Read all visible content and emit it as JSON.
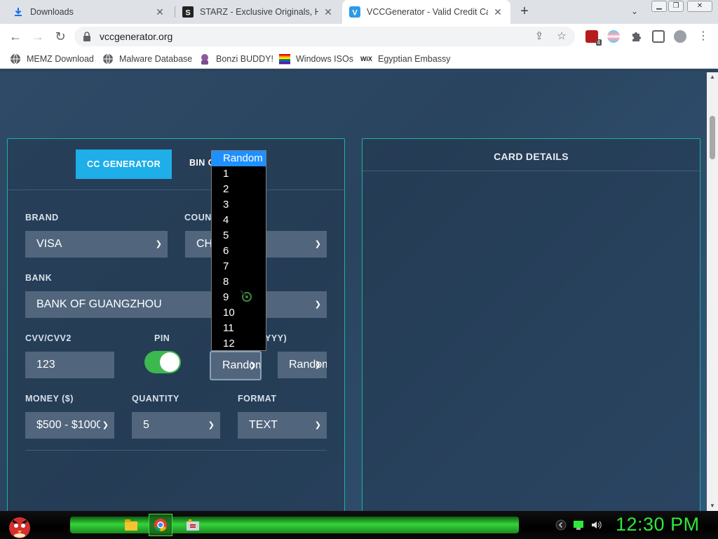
{
  "browser": {
    "tabs": [
      {
        "label": "Downloads",
        "favicon": "download-icon"
      },
      {
        "label": "STARZ - Exclusive Originals, Hit M",
        "favicon": "starz-icon"
      },
      {
        "label": "VCCGenerator - Valid Credit Card",
        "favicon": "vcc-icon",
        "active": true
      }
    ],
    "url": "vccgenerator.org",
    "bookmarks": [
      {
        "label": "MEMZ Download",
        "icon": "globe-icon"
      },
      {
        "label": "Malware Database",
        "icon": "globe-icon"
      },
      {
        "label": "Bonzi BUDDY!",
        "icon": "bonzi-icon"
      },
      {
        "label": "Windows ISOs",
        "icon": "windows-icon"
      },
      {
        "label": "Egyptian Embassy",
        "icon": "wix-icon"
      }
    ],
    "wix_mark": "WiX",
    "extension_badge": "4"
  },
  "generator": {
    "tab_cc": "CC GENERATOR",
    "tab_bin": "BIN CHECKER",
    "brand_label": "BRAND",
    "brand_value": "VISA",
    "country_label": "COUNTRY",
    "country_value": "CHINA",
    "bank_label": "BANK",
    "bank_value": "BANK OF GUANGZHOU",
    "cvv_label": "CVV/CVV2",
    "cvv_value": "123",
    "pin_label": "PIN",
    "pin_enabled": true,
    "date_label": "YYY)",
    "month_value": "Random",
    "year_value": "Random",
    "money_label": "MONEY ($)",
    "money_value": "$500 - $1000",
    "quantity_label": "QUANTITY",
    "quantity_value": "5",
    "format_label": "FORMAT",
    "format_value": "TEXT"
  },
  "month_dropdown": {
    "options": [
      "Random",
      "1",
      "2",
      "3",
      "4",
      "5",
      "6",
      "7",
      "8",
      "9",
      "10",
      "11",
      "12"
    ],
    "highlighted": "Random"
  },
  "card_details": {
    "title": "CARD DETAILS"
  },
  "taskbar": {
    "clock": "12:30 PM"
  },
  "colors": {
    "accent": "#1eaee8",
    "panel_border": "#1bb3a0",
    "toggle_on": "#3cb84f",
    "clock": "#2ee83a"
  }
}
